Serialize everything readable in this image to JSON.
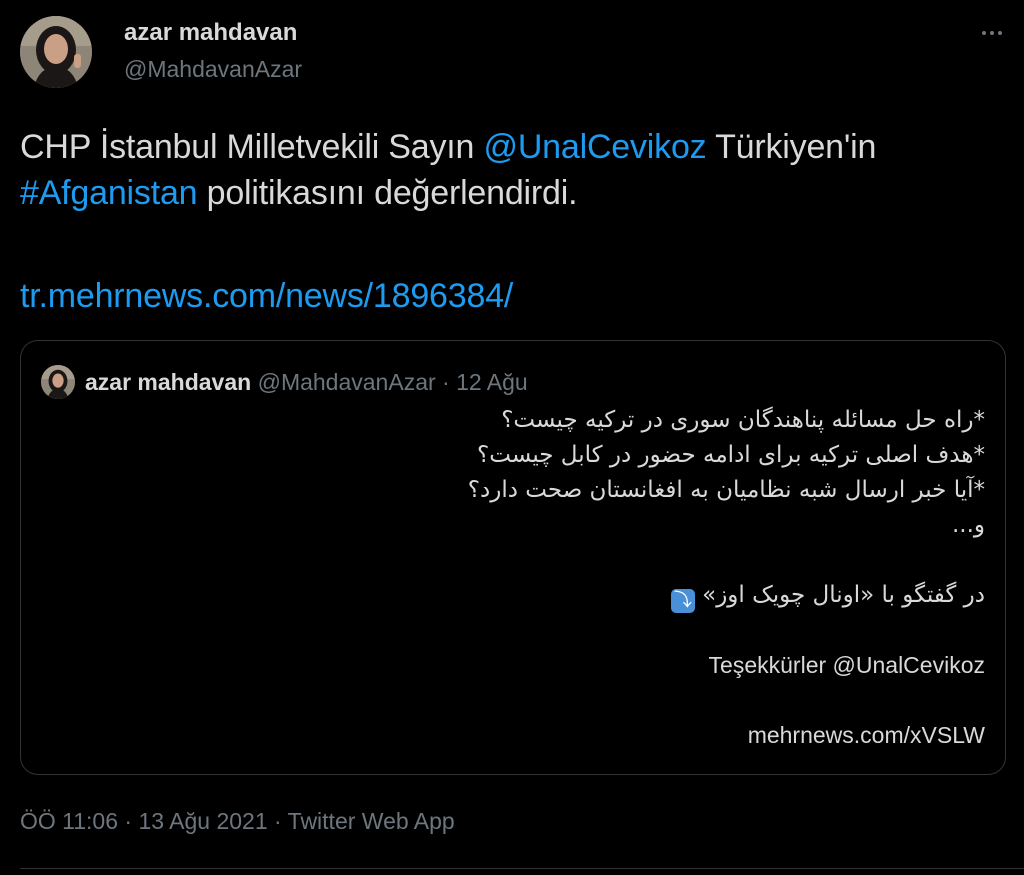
{
  "author": {
    "name": "azar mahdavan",
    "handle": "@MahdavanAzar"
  },
  "icons": {
    "more": "more-horizontal-icon",
    "arrow": "right-arrow-curving-down-icon"
  },
  "tweet": {
    "line1_pre": "CHP İstanbul Milletvekili Sayın ",
    "mention": "@UnalCevikoz",
    "line1_post": " Türkiyen'in",
    "hashtag": "#Afganistan",
    "line2_post": " politikasını değerlendirdi.",
    "url": "tr.mehrnews.com/news/1896384/"
  },
  "quote": {
    "name": "azar mahdavan",
    "meta": " @MahdavanAzar · 12 Ağu",
    "fa_lines": [
      "*راه حل مسائله پناهندگان سوری در ترکیه چیست؟",
      "*هدف اصلی ترکیه برای ادامه حضور در کابل چیست؟",
      "*آیا خبر ارسال شبه نظامیان به افغانستان صحت دارد؟",
      "و..."
    ],
    "conversation": "در گفتگو با «اونال چویک اوز»",
    "arrow_glyph": "⤵",
    "thanks": "Teşekkürler @UnalCevikoz",
    "link": "mehrnews.com/xVSLW"
  },
  "footer": {
    "time": "ÖÖ 11:06 · 13 Ağu 2021 · ",
    "source": "Twitter Web App"
  },
  "colors": {
    "background": "#000000",
    "text": "#d9d9d9",
    "secondary": "#6e767d",
    "link": "#1d9bf0",
    "border": "#2f3336"
  }
}
